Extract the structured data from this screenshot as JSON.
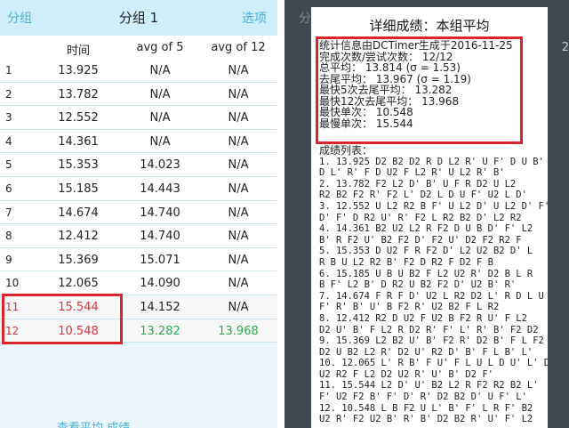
{
  "left": {
    "back_label": "分组",
    "title": "分组 1",
    "options_label": "选项",
    "columns": [
      "",
      "时间",
      "avg of 5",
      "avg of 12"
    ],
    "rows": [
      {
        "n": "1",
        "time": "13.925",
        "avg5": "N/A",
        "avg12": "N/A"
      },
      {
        "n": "2",
        "time": "13.782",
        "avg5": "N/A",
        "avg12": "N/A"
      },
      {
        "n": "3",
        "time": "12.552",
        "avg5": "N/A",
        "avg12": "N/A"
      },
      {
        "n": "4",
        "time": "14.361",
        "avg5": "N/A",
        "avg12": "N/A"
      },
      {
        "n": "5",
        "time": "15.353",
        "avg5": "14.023",
        "avg12": "N/A"
      },
      {
        "n": "6",
        "time": "15.185",
        "avg5": "14.443",
        "avg12": "N/A"
      },
      {
        "n": "7",
        "time": "14.674",
        "avg5": "14.740",
        "avg12": "N/A"
      },
      {
        "n": "8",
        "time": "12.412",
        "avg5": "14.740",
        "avg12": "N/A"
      },
      {
        "n": "9",
        "time": "15.369",
        "avg5": "15.071",
        "avg12": "N/A"
      },
      {
        "n": "10",
        "time": "12.065",
        "avg5": "14.090",
        "avg12": "N/A"
      },
      {
        "n": "11",
        "time": "15.544",
        "avg5": "14.152",
        "avg12": "N/A"
      },
      {
        "n": "12",
        "time": "10.548",
        "avg5": "13.282",
        "avg12": "13.968"
      }
    ],
    "bottom_text": "查看平均 成绩 …"
  },
  "right": {
    "bg_left": "分",
    "bg_right": "2",
    "dialog_title": "详细成绩：本组平均",
    "stats": [
      "统计信息由DCTimer生成于2016-11-25",
      "完成次数/尝试次数：  12/12",
      "总平均：  13.814  (σ = 1.53)",
      "去尾平均：  13.967  (σ = 1.19)",
      "最快5次去尾平均：  13.282",
      "最快12次去尾平均：  13.968",
      "最快单次：  10.548",
      "最慢单次：  15.544"
    ],
    "list_header": "成绩列表：",
    "list": [
      "1. 13.925  D2 B2 D2 R D L2 R' U F' D U B'",
      "D L' R' F D U2 F L2 R' U L2 R' B'",
      "2. 13.782  F2 L2 D' B' U F R D2 U L2",
      "R2 B2 F2 R' F2 L' D2 L D U F' U2 L D'",
      "3. 12.552  U L2 R2 B F' U L2 D' U L2 D' F'",
      "D' F' D R2 U' R' F2 L R2 B2 D' L2 R2",
      "4. 14.361  B2 U2 L2 R F2 D U B D' F' L2",
      "B' R F2 U' B2 F2 D' F2 U' D2 F2 R2 F",
      "5. 15.353  D U2 F R F2 D' L2 U2 B2 D' L",
      "R B U L2 R2 B' F2 D R2 F D2 F B",
      "6. 15.185  U B U B2 F L2 U2 R' D2 B L R",
      "B F' L2 B' D R2 U B2 F2 D' U2 B' R'",
      "7. 14.674  F R F D' U2 L R2 D2 L' R D L U",
      "F' R' B' U' B F2 R' U2 B2 F L R2",
      "8. 12.412  R2 D U2 F U2 B F2 R U' F L2",
      "D2 U' B' F L2 R D2 R' F' L' R' B' F2 D2",
      "9. 15.369  L2 B2 U' B' F2 R' D2 B' F L F2",
      "D2 U B2 L2 R' D2 U' R2 D' B' F L B' L'",
      "10. 12.065  L' R B' F U' F L U L D U' L' D2",
      "U2 R2 F L2 D2 U2 R' U' B' D2 F'",
      "11. 15.544  L2 D' U' B2 L2 R F2 R2 B2 L'",
      "F' U2 F2 B' F' D' R' D2 B2 D' U F' L'",
      "12. 10.548  L B F2 U L' B' F' L R F' B2",
      "U2 R' F2 U2 B' R' B' D2 B2 R' U' F' L2"
    ]
  }
}
